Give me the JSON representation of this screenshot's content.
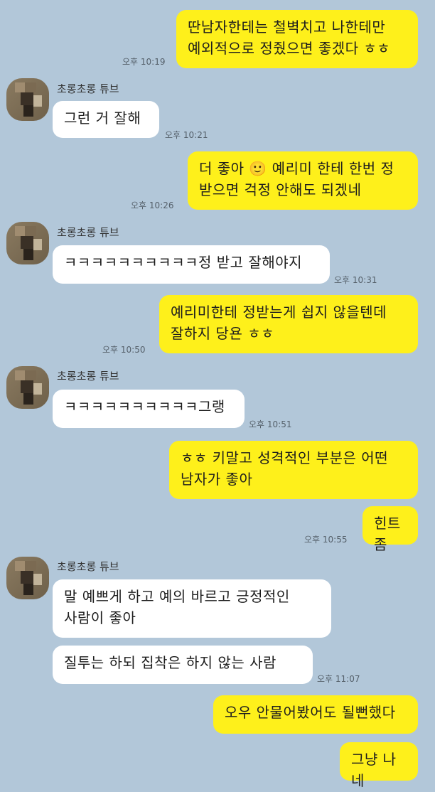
{
  "contact": {
    "name": "초롱초롱 튜브"
  },
  "messages": [
    {
      "text": "딴남자한테는 철벽치고 나한테만\n예외적으로 정줬으면 좋겠다 ㅎㅎ",
      "time": "오후 10:19"
    },
    {
      "text": "그런 거 잘해",
      "time": "오후 10:21"
    },
    {
      "text": "더 좋아 🙂 예리미 한테 한번 정\n받으면 걱정 안해도 되겠네",
      "time": "오후 10:26"
    },
    {
      "text": "ㅋㅋㅋㅋㅋㅋㅋㅋㅋㅋ정 받고 잘해야지",
      "time": "오후 10:31"
    },
    {
      "text": "예리미한테 정받는게 쉽지 않을텐데\n잘하지 당욘 ㅎㅎ",
      "time": "오후 10:50"
    },
    {
      "text": "ㅋㅋㅋㅋㅋㅋㅋㅋㅋㅋ그랭",
      "time": "오후 10:51"
    },
    {
      "text": "ㅎㅎ 키말고 성격적인 부분은 어떤\n남자가 좋아",
      "time": ""
    },
    {
      "text": "힌트좀",
      "time": "오후 10:55"
    },
    {
      "text": "말 예쁘게 하고 예의 바르고 긍정적인\n사람이 좋아",
      "time": ""
    },
    {
      "text": "질투는 하되 집착은 하지 않는 사람",
      "time": "오후 11:07"
    },
    {
      "text": "오우 안물어봤어도 될뻔했다",
      "time": ""
    },
    {
      "text": "그냥 나네",
      "time": ""
    }
  ]
}
